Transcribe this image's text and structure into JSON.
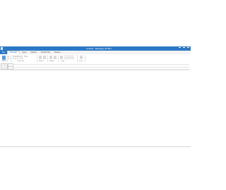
{
  "window": {
    "title": "Untitled - Message (HTML)"
  },
  "tabs": [
    {
      "label": "File"
    },
    {
      "label": "Message"
    },
    {
      "label": "Insert"
    },
    {
      "label": "Options"
    },
    {
      "label": "Format Text"
    },
    {
      "label": "Review"
    }
  ],
  "ribbon": {
    "groups": [
      "Clipboard",
      "Basic Text",
      "Names",
      "Include",
      "Tags",
      "Zoom"
    ]
  },
  "colors": {
    "accent": "#2b78c4"
  },
  "icons": [
    "minimize-icon",
    "maximize-icon",
    "close-icon",
    "send-icon",
    "paste-icon",
    "flag-icon"
  ]
}
